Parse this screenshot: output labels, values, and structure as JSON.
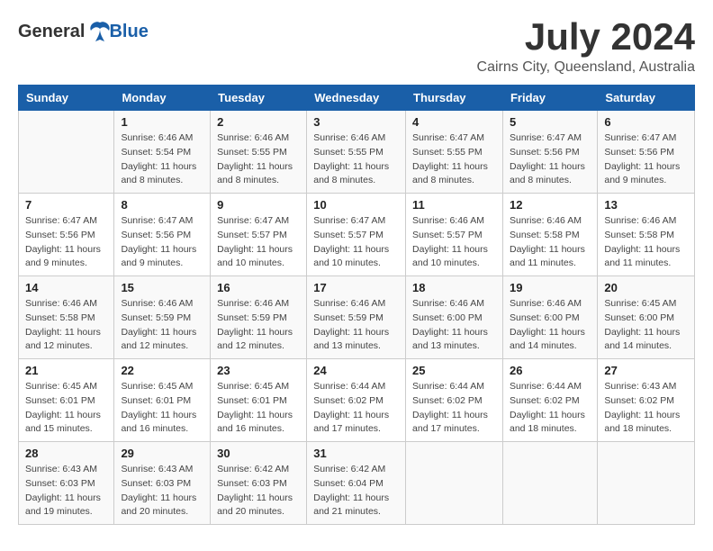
{
  "header": {
    "logo_general": "General",
    "logo_blue": "Blue",
    "month": "July 2024",
    "location": "Cairns City, Queensland, Australia"
  },
  "weekdays": [
    "Sunday",
    "Monday",
    "Tuesday",
    "Wednesday",
    "Thursday",
    "Friday",
    "Saturday"
  ],
  "weeks": [
    [
      {
        "day": "",
        "info": ""
      },
      {
        "day": "1",
        "info": "Sunrise: 6:46 AM\nSunset: 5:54 PM\nDaylight: 11 hours and 8 minutes."
      },
      {
        "day": "2",
        "info": "Sunrise: 6:46 AM\nSunset: 5:55 PM\nDaylight: 11 hours and 8 minutes."
      },
      {
        "day": "3",
        "info": "Sunrise: 6:46 AM\nSunset: 5:55 PM\nDaylight: 11 hours and 8 minutes."
      },
      {
        "day": "4",
        "info": "Sunrise: 6:47 AM\nSunset: 5:55 PM\nDaylight: 11 hours and 8 minutes."
      },
      {
        "day": "5",
        "info": "Sunrise: 6:47 AM\nSunset: 5:56 PM\nDaylight: 11 hours and 8 minutes."
      },
      {
        "day": "6",
        "info": "Sunrise: 6:47 AM\nSunset: 5:56 PM\nDaylight: 11 hours and 9 minutes."
      }
    ],
    [
      {
        "day": "7",
        "info": "Sunrise: 6:47 AM\nSunset: 5:56 PM\nDaylight: 11 hours and 9 minutes."
      },
      {
        "day": "8",
        "info": "Sunrise: 6:47 AM\nSunset: 5:56 PM\nDaylight: 11 hours and 9 minutes."
      },
      {
        "day": "9",
        "info": "Sunrise: 6:47 AM\nSunset: 5:57 PM\nDaylight: 11 hours and 10 minutes."
      },
      {
        "day": "10",
        "info": "Sunrise: 6:47 AM\nSunset: 5:57 PM\nDaylight: 11 hours and 10 minutes."
      },
      {
        "day": "11",
        "info": "Sunrise: 6:46 AM\nSunset: 5:57 PM\nDaylight: 11 hours and 10 minutes."
      },
      {
        "day": "12",
        "info": "Sunrise: 6:46 AM\nSunset: 5:58 PM\nDaylight: 11 hours and 11 minutes."
      },
      {
        "day": "13",
        "info": "Sunrise: 6:46 AM\nSunset: 5:58 PM\nDaylight: 11 hours and 11 minutes."
      }
    ],
    [
      {
        "day": "14",
        "info": "Sunrise: 6:46 AM\nSunset: 5:58 PM\nDaylight: 11 hours and 12 minutes."
      },
      {
        "day": "15",
        "info": "Sunrise: 6:46 AM\nSunset: 5:59 PM\nDaylight: 11 hours and 12 minutes."
      },
      {
        "day": "16",
        "info": "Sunrise: 6:46 AM\nSunset: 5:59 PM\nDaylight: 11 hours and 12 minutes."
      },
      {
        "day": "17",
        "info": "Sunrise: 6:46 AM\nSunset: 5:59 PM\nDaylight: 11 hours and 13 minutes."
      },
      {
        "day": "18",
        "info": "Sunrise: 6:46 AM\nSunset: 6:00 PM\nDaylight: 11 hours and 13 minutes."
      },
      {
        "day": "19",
        "info": "Sunrise: 6:46 AM\nSunset: 6:00 PM\nDaylight: 11 hours and 14 minutes."
      },
      {
        "day": "20",
        "info": "Sunrise: 6:45 AM\nSunset: 6:00 PM\nDaylight: 11 hours and 14 minutes."
      }
    ],
    [
      {
        "day": "21",
        "info": "Sunrise: 6:45 AM\nSunset: 6:01 PM\nDaylight: 11 hours and 15 minutes."
      },
      {
        "day": "22",
        "info": "Sunrise: 6:45 AM\nSunset: 6:01 PM\nDaylight: 11 hours and 16 minutes."
      },
      {
        "day": "23",
        "info": "Sunrise: 6:45 AM\nSunset: 6:01 PM\nDaylight: 11 hours and 16 minutes."
      },
      {
        "day": "24",
        "info": "Sunrise: 6:44 AM\nSunset: 6:02 PM\nDaylight: 11 hours and 17 minutes."
      },
      {
        "day": "25",
        "info": "Sunrise: 6:44 AM\nSunset: 6:02 PM\nDaylight: 11 hours and 17 minutes."
      },
      {
        "day": "26",
        "info": "Sunrise: 6:44 AM\nSunset: 6:02 PM\nDaylight: 11 hours and 18 minutes."
      },
      {
        "day": "27",
        "info": "Sunrise: 6:43 AM\nSunset: 6:02 PM\nDaylight: 11 hours and 18 minutes."
      }
    ],
    [
      {
        "day": "28",
        "info": "Sunrise: 6:43 AM\nSunset: 6:03 PM\nDaylight: 11 hours and 19 minutes."
      },
      {
        "day": "29",
        "info": "Sunrise: 6:43 AM\nSunset: 6:03 PM\nDaylight: 11 hours and 20 minutes."
      },
      {
        "day": "30",
        "info": "Sunrise: 6:42 AM\nSunset: 6:03 PM\nDaylight: 11 hours and 20 minutes."
      },
      {
        "day": "31",
        "info": "Sunrise: 6:42 AM\nSunset: 6:04 PM\nDaylight: 11 hours and 21 minutes."
      },
      {
        "day": "",
        "info": ""
      },
      {
        "day": "",
        "info": ""
      },
      {
        "day": "",
        "info": ""
      }
    ]
  ]
}
